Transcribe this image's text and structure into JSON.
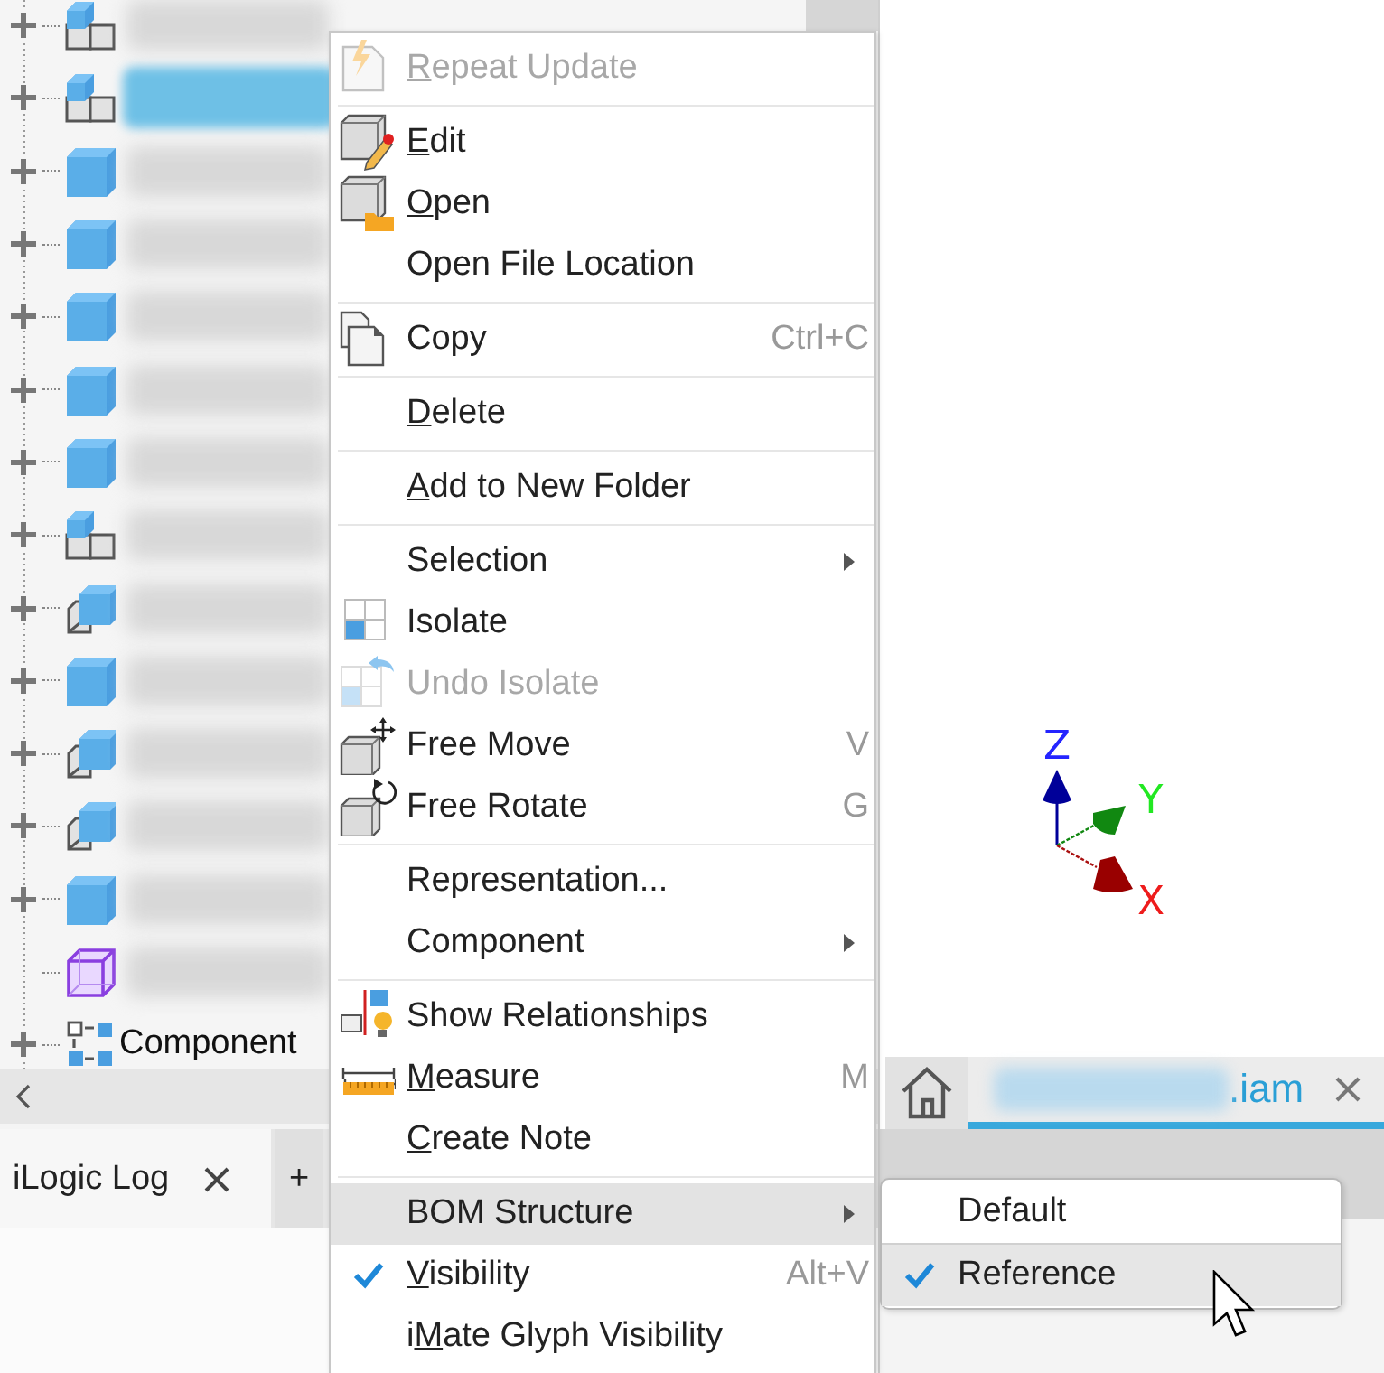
{
  "browser": {
    "rows": [
      {
        "kind": "assembly",
        "expandable": true,
        "selected": false,
        "blurred": true
      },
      {
        "kind": "assembly",
        "expandable": true,
        "selected": true,
        "blurred": true
      },
      {
        "kind": "part",
        "expandable": true,
        "selected": false,
        "blurred": true
      },
      {
        "kind": "part",
        "expandable": true,
        "selected": false,
        "blurred": true
      },
      {
        "kind": "part",
        "expandable": true,
        "selected": false,
        "blurred": true
      },
      {
        "kind": "part",
        "expandable": true,
        "selected": false,
        "blurred": true
      },
      {
        "kind": "part",
        "expandable": true,
        "selected": false,
        "blurred": true
      },
      {
        "kind": "assembly",
        "expandable": true,
        "selected": false,
        "blurred": true
      },
      {
        "kind": "derived",
        "expandable": true,
        "selected": false,
        "blurred": true
      },
      {
        "kind": "part",
        "expandable": true,
        "selected": false,
        "blurred": true
      },
      {
        "kind": "derived",
        "expandable": true,
        "selected": false,
        "blurred": true
      },
      {
        "kind": "derived",
        "expandable": true,
        "selected": false,
        "blurred": true
      },
      {
        "kind": "part",
        "expandable": true,
        "selected": false,
        "blurred": true
      },
      {
        "kind": "virtual",
        "expandable": false,
        "selected": false,
        "blurred": true
      },
      {
        "kind": "pattern",
        "expandable": true,
        "selected": false,
        "blurred": false,
        "label": "Component"
      }
    ]
  },
  "context_menu": {
    "items": [
      {
        "kind": "item",
        "key": "R",
        "rest": "epeat Update",
        "disabled": true,
        "checked": false,
        "selected": false,
        "submenu": false
      },
      {
        "kind": "separator"
      },
      {
        "kind": "item",
        "key": "E",
        "rest": "dit",
        "disabled": false,
        "checked": false,
        "selected": false,
        "submenu": false
      },
      {
        "kind": "item",
        "key": "O",
        "rest": "pen",
        "disabled": false,
        "checked": false,
        "selected": false,
        "submenu": false
      },
      {
        "kind": "item",
        "label": "Open File Location",
        "disabled": false,
        "checked": false,
        "selected": false,
        "submenu": false
      },
      {
        "kind": "separator"
      },
      {
        "kind": "item",
        "label": "Copy",
        "shortcut": "Ctrl+C",
        "disabled": false,
        "checked": false,
        "selected": false,
        "submenu": false
      },
      {
        "kind": "separator"
      },
      {
        "kind": "item",
        "key": "D",
        "rest": "elete",
        "disabled": false,
        "checked": false,
        "selected": false,
        "submenu": false
      },
      {
        "kind": "separator"
      },
      {
        "kind": "item",
        "key": "A",
        "rest": "dd to New Folder",
        "disabled": false,
        "checked": false,
        "selected": false,
        "submenu": false
      },
      {
        "kind": "separator"
      },
      {
        "kind": "item",
        "label": "Selection",
        "disabled": false,
        "checked": false,
        "selected": false,
        "submenu": true
      },
      {
        "kind": "item",
        "label": "Isolate",
        "disabled": false,
        "checked": false,
        "selected": false,
        "submenu": false
      },
      {
        "kind": "item",
        "label": "Undo Isolate",
        "disabled": true,
        "checked": false,
        "selected": false,
        "submenu": false
      },
      {
        "kind": "item",
        "label": "Free Move",
        "shortcut": "V",
        "disabled": false,
        "checked": false,
        "selected": false,
        "submenu": false
      },
      {
        "kind": "item",
        "label": "Free Rotate",
        "shortcut": "G",
        "disabled": false,
        "checked": false,
        "selected": false,
        "submenu": false
      },
      {
        "kind": "separator"
      },
      {
        "kind": "item",
        "label": "Representation...",
        "disabled": false,
        "checked": false,
        "selected": false,
        "submenu": false
      },
      {
        "kind": "item",
        "label": "Component",
        "disabled": false,
        "checked": false,
        "selected": false,
        "submenu": true
      },
      {
        "kind": "separator"
      },
      {
        "kind": "item",
        "label": "Show Relationships",
        "disabled": false,
        "checked": false,
        "selected": false,
        "submenu": false
      },
      {
        "kind": "item",
        "key": "M",
        "rest": "easure",
        "shortcut": "M",
        "disabled": false,
        "checked": false,
        "selected": false,
        "submenu": false
      },
      {
        "kind": "item",
        "key": "C",
        "rest": "reate Note",
        "disabled": false,
        "checked": false,
        "selected": false,
        "submenu": false
      },
      {
        "kind": "separator"
      },
      {
        "kind": "item",
        "label": "BOM Structure",
        "disabled": false,
        "checked": false,
        "selected": true,
        "submenu": true
      },
      {
        "kind": "item",
        "key": "V",
        "rest": "isibility",
        "shortcut": "Alt+V",
        "disabled": false,
        "checked": true,
        "selected": false,
        "submenu": false
      },
      {
        "kind": "item",
        "lead": "i",
        "key": "M",
        "rest": "ate Glyph Visibility",
        "disabled": false,
        "checked": false,
        "selected": false,
        "submenu": false
      }
    ]
  },
  "submenu": {
    "items": [
      {
        "label": "Default",
        "checked": false,
        "selected": false
      },
      {
        "label": "Reference",
        "checked": true,
        "selected": true
      }
    ]
  },
  "viewport": {
    "axes": [
      {
        "label": "Z",
        "color": "#2424ff"
      },
      {
        "label": "Y",
        "color": "#22e822"
      },
      {
        "label": "X",
        "color": "#ee1c1c"
      }
    ]
  },
  "document_tab": {
    "label": ".iam",
    "selected": true
  },
  "panel_tabs": [
    {
      "label": "iLogic Log",
      "selected": true,
      "closable": true
    },
    {
      "label": "+",
      "selected": false,
      "closable": false
    }
  ]
}
